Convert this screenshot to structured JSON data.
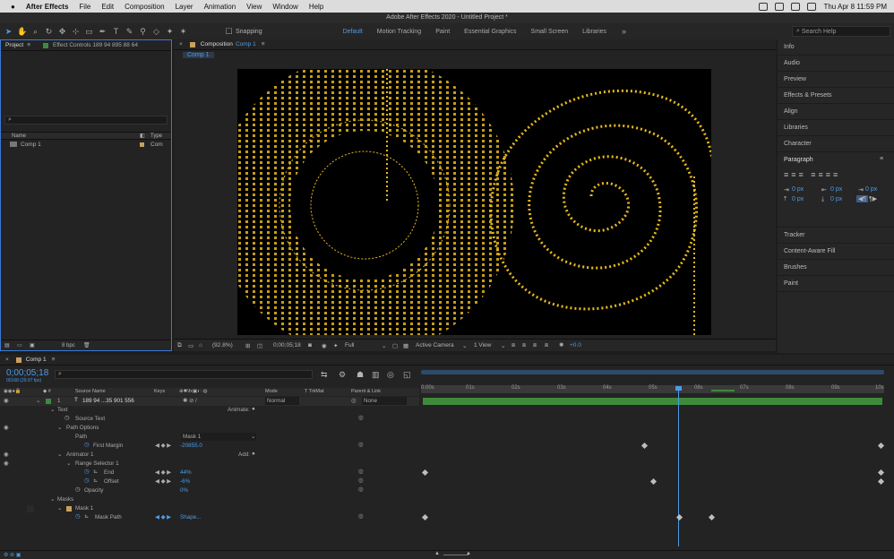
{
  "menubar": {
    "app_name": "After Effects",
    "items": [
      "File",
      "Edit",
      "Composition",
      "Layer",
      "Animation",
      "View",
      "Window",
      "Help"
    ],
    "clock": "Thu Apr 8  11:59 PM"
  },
  "window_title": "Adobe After Effects 2020 - Untitled Project *",
  "toolbar": {
    "snapping_label": "Snapping",
    "workspaces": [
      "Default",
      "Motion Tracking",
      "Paint",
      "Essential Graphics",
      "Small Screen",
      "Libraries"
    ],
    "active_workspace": "Default",
    "search_placeholder": "Search Help"
  },
  "project_panel": {
    "tab_project": "Project",
    "tab_effect_controls": "Effect Controls 189 94 895 88 64",
    "col_name": "Name",
    "col_type": "Type",
    "items": [
      {
        "name": "Comp 1",
        "type": "Com"
      }
    ],
    "bpc": "8 bpc"
  },
  "comp_panel": {
    "tab_label": "Composition",
    "tab_comp_name": "Comp 1",
    "sub_tab": "Comp 1",
    "zoom": "(92.8%)",
    "timecode": "0;00;05;18",
    "resolution": "Full",
    "camera": "Active Camera",
    "view": "1 View",
    "exposure": "+0.0"
  },
  "right_panel": {
    "items_top": [
      "Info",
      "Audio",
      "Preview",
      "Effects & Presets",
      "Align",
      "Libraries",
      "Character"
    ],
    "paragraph_title": "Paragraph",
    "paragraph_values": [
      "0 px",
      "0 px",
      "0 px",
      "0 px",
      "0 px"
    ],
    "items_bottom": [
      "Tracker",
      "Content-Aware Fill",
      "Brushes",
      "Paint"
    ]
  },
  "timeline": {
    "tab": "Comp 1",
    "timecode": "0;00;05;18",
    "fps_info": "00168 (29.97 fps)",
    "columns": {
      "source_name": "Source Name",
      "keys": "Keys",
      "mode": "Mode",
      "trkmat": "T  TrkMat",
      "parent": "Parent & Link"
    },
    "layer": {
      "index": "1",
      "name": "189 94 ...35 901 556",
      "mode": "Normal",
      "parent": "None"
    },
    "props": {
      "text": "Text",
      "animate_label": "Animate:",
      "source_text": "Source Text",
      "path_options": "Path Options",
      "path": "Path",
      "path_value": "Mask 1",
      "first_margin": "First Margin",
      "first_margin_value": "-20855.0",
      "animator": "Animator 1",
      "add_label": "Add:",
      "range_selector": "Range Selector 1",
      "end": "End",
      "end_value": "44%",
      "offset": "Offset",
      "offset_value": "-6%",
      "opacity": "Opacity",
      "opacity_value": "0%",
      "masks": "Masks",
      "mask1": "Mask 1",
      "mask_path": "Mask Path",
      "mask_path_value": "Shape..."
    },
    "ruler": [
      "0:00s",
      "01s",
      "02s",
      "03s",
      "04s",
      "05s",
      "06s",
      "07s",
      "08s",
      "09s",
      "10s"
    ]
  },
  "colors": {
    "accent": "#4d9be6",
    "text_gold": "#e8b91c",
    "layer_bar": "#3e8a3b"
  }
}
